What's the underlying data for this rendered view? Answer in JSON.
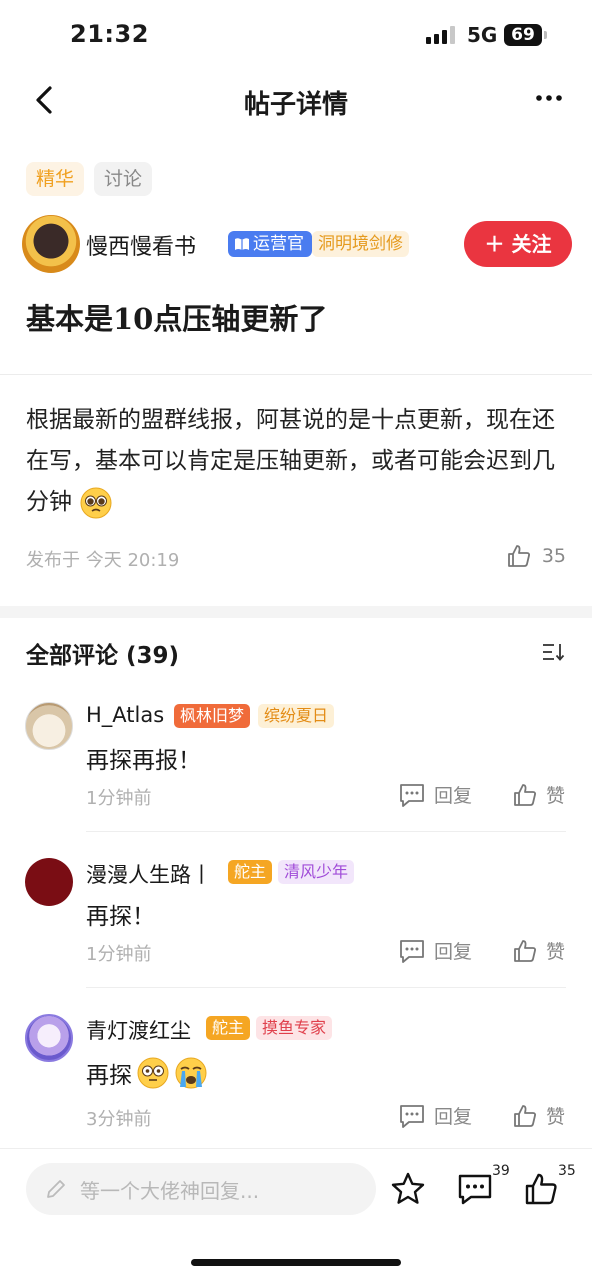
{
  "status_bar": {
    "time": "21:32",
    "network": "5G",
    "battery": "69"
  },
  "nav": {
    "title": "帖子详情",
    "back_icon": "chevron-left-icon",
    "more_icon": "more-dots-icon"
  },
  "post": {
    "tags": [
      "精华",
      "讨论"
    ],
    "author": {
      "name": "慢西慢看书",
      "role_badge": "运营官",
      "realm_badge": "洞明境剑修"
    },
    "follow_label": "关注",
    "title": "基本是10点压轴更新了",
    "body": "根据最新的盟群线报，阿甚说的是十点更新，现在还在写，基本可以肯定是压轴更新，或者可能会迟到几分钟",
    "published": "发布于 今天 20:19",
    "likes": "35"
  },
  "comments_section": {
    "title": "全部评论 (39)",
    "reply_label": "回复",
    "like_label": "赞"
  },
  "comments": [
    {
      "name": "H_Atlas",
      "badges": [
        "枫林旧梦",
        "缤纷夏日"
      ],
      "text": "再探再报！",
      "time": "1分钟前"
    },
    {
      "name": "漫漫人生路丨",
      "badges": [
        "舵主",
        "清风少年"
      ],
      "text": "再探！",
      "time": "1分钟前"
    },
    {
      "name": "青灯渡红尘",
      "badges": [
        "舵主",
        "摸鱼专家"
      ],
      "text": "再探",
      "time": "3分钟前"
    }
  ],
  "bottom_bar": {
    "input_placeholder": "等一个大佬神回复...",
    "comment_count": "39",
    "like_count": "35"
  },
  "colors": {
    "accent_red": "#ea3540",
    "gold": "#f0a020",
    "blue": "#4a7cf0"
  }
}
